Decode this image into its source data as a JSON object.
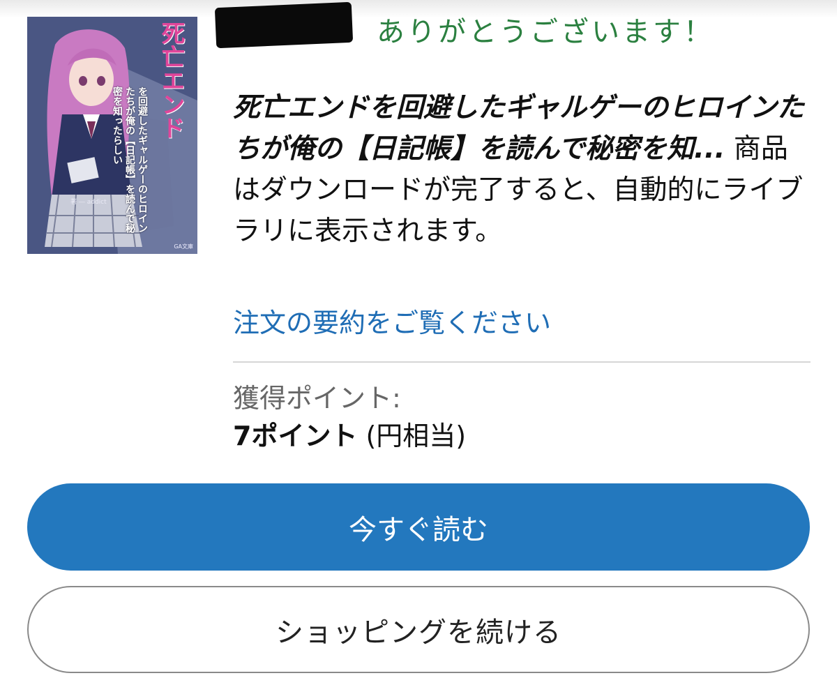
{
  "confirmation": {
    "thanks_text": "ありがとうございます！",
    "product_title": "死亡エンドを回避したギャルゲーのヒロインたちが俺の【日記帳】を読んで秘密を知...",
    "message_text": " 商品はダウンロードが完了すると、自動的にライブラリに表示されます。",
    "summary_link": "注文の要約をご覧ください"
  },
  "cover": {
    "title_text": "死亡エンド",
    "subtitle_text": "を回避したギャルゲーのヒロインたちが俺の【日記帳】を読んで秘密を知ったらしい",
    "author_text": "著 ― addict",
    "publisher_text": "GA文庫"
  },
  "points": {
    "label": "獲得ポイント:",
    "value": "7ポイント",
    "note": "(円相当)"
  },
  "actions": {
    "read_now_label": "今すぐ読む",
    "continue_shopping_label": "ショッピングを続ける"
  },
  "colors": {
    "thanks_green": "#2b8040",
    "link_blue": "#1f6db5",
    "primary_button": "#2378be",
    "cover_title_pink": "#e0459a"
  }
}
